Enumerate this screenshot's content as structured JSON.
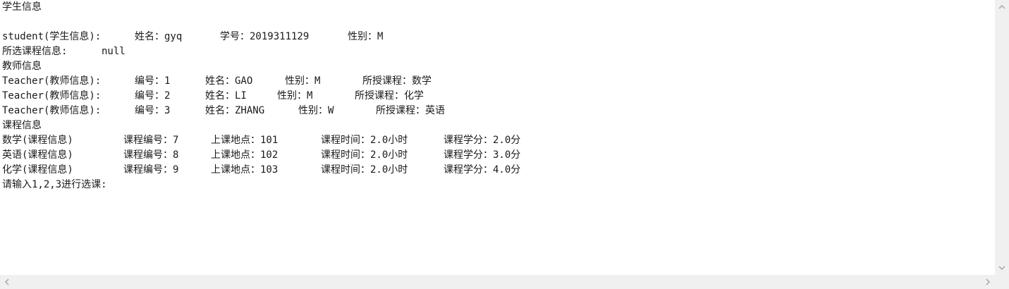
{
  "console": {
    "section_student": "学生信息",
    "student_prefix": "student(学生信息):",
    "student_name": "姓名：gyq",
    "student_id": "学号：2019311129",
    "student_gender": "性别：M",
    "course_selected_label": "所选课程信息:",
    "course_selected_value": "null",
    "section_teacher": "教师信息",
    "teachers": [
      {
        "prefix": "Teacher(教师信息):",
        "id": "编号：1",
        "name": "姓名：GAO",
        "gender": "性别：M",
        "course": "所授课程：数学"
      },
      {
        "prefix": "Teacher(教师信息):",
        "id": "编号：2",
        "name": "姓名：LI",
        "gender": "性别：M",
        "course": "所授课程：化学"
      },
      {
        "prefix": "Teacher(教师信息):",
        "id": "编号：3",
        "name": "姓名：ZHANG",
        "gender": "性别：W",
        "course": "所授课程：英语"
      }
    ],
    "section_course": "课程信息",
    "courses": [
      {
        "name": "数学(课程信息)",
        "id": "课程编号：7",
        "room": "上课地点：101",
        "time": "课程时间：2.0小时",
        "credit": "课程学分：2.0分"
      },
      {
        "name": "英语(课程信息)",
        "id": "课程编号：8",
        "room": "上课地点：102",
        "time": "课程时间：2.0小时",
        "credit": "课程学分：3.0分"
      },
      {
        "name": "化学(课程信息)",
        "id": "课程编号：9",
        "room": "上课地点：103",
        "time": "课程时间：2.0小时",
        "credit": "课程学分：4.0分"
      }
    ],
    "prompt": "请输入1,2,3进行选课:"
  },
  "scrollbar": {
    "up_icon": "chevron-up-icon",
    "down_icon": "chevron-down-icon",
    "left_icon": "chevron-left-icon",
    "right_icon": "chevron-right-icon",
    "track_color": "#f0f0f0",
    "arrow_color": "#a0a0a0"
  }
}
